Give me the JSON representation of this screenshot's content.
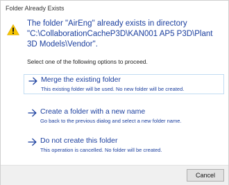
{
  "window": {
    "title": "Folder Already Exists"
  },
  "message": {
    "icon": "warning-icon",
    "headline": "The folder \"AirEng\" already exists in directory \"C:\\CollaborationCacheP3D\\KAN001 AP5 P3D\\Plant 3D Models\\Vendor\".",
    "instruction": "Select one of the following options to proceed."
  },
  "options": [
    {
      "icon": "arrow-right-icon",
      "title": "Merge the existing folder",
      "description": "This existing folder will be used. No new folder will be created."
    },
    {
      "icon": "arrow-right-icon",
      "title": "Create a folder with a new name",
      "description": "Go back to the previous dialog and select a new folder name."
    },
    {
      "icon": "arrow-right-icon",
      "title": "Do not create this folder",
      "description": "This operation is cancelled. No folder will be created."
    }
  ],
  "footer": {
    "cancel_label": "Cancel"
  },
  "colors": {
    "link_blue": "#1a3e9e",
    "warning_yellow": "#f7c600",
    "footer_bg": "#f0f0f0"
  }
}
